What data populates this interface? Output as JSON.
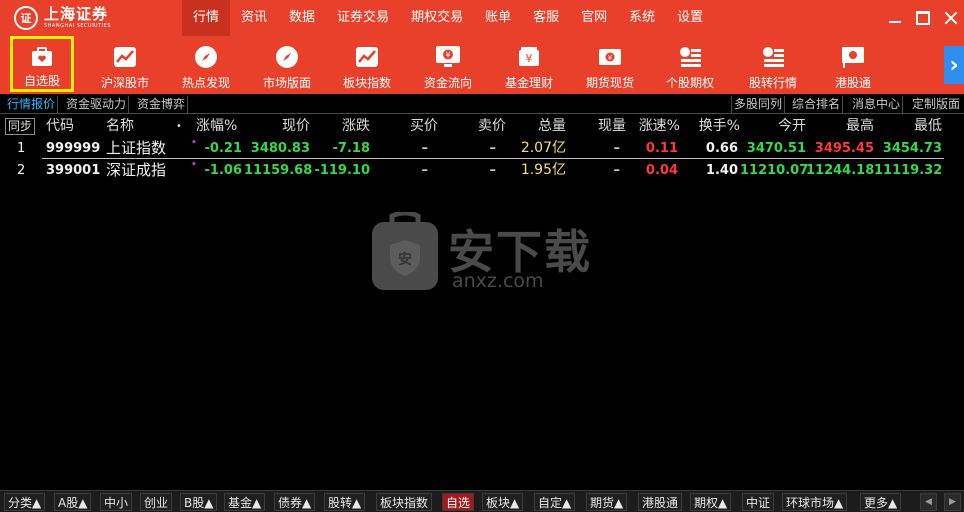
{
  "app": {
    "logo_cn": "上海证券",
    "logo_en": "SHANGHAI SECURITIES"
  },
  "menu": [
    {
      "label": "行情",
      "active": true
    },
    {
      "label": "资讯"
    },
    {
      "label": "数据"
    },
    {
      "label": "证券交易"
    },
    {
      "label": "期权交易"
    },
    {
      "label": "账单"
    },
    {
      "label": "客服"
    },
    {
      "label": "官网"
    },
    {
      "label": "系统"
    },
    {
      "label": "设置"
    }
  ],
  "toolbar": [
    {
      "label": "自选股",
      "icon": "favorites-bag-icon",
      "selected": true
    },
    {
      "label": "沪深股市",
      "icon": "trend-chart-icon"
    },
    {
      "label": "热点发现",
      "icon": "compass-icon"
    },
    {
      "label": "市场版面",
      "icon": "compass-icon"
    },
    {
      "label": "板块指数",
      "icon": "trend-chart-icon"
    },
    {
      "label": "资金流向",
      "icon": "monitor-yen-icon"
    },
    {
      "label": "基金理财",
      "icon": "yen-card-icon"
    },
    {
      "label": "期货现货",
      "icon": "banknote-icon"
    },
    {
      "label": "个股期权",
      "icon": "coin-stack-icon"
    },
    {
      "label": "股转行情",
      "icon": "coin-stack-icon"
    },
    {
      "label": "港股通",
      "icon": "hk-flag-icon"
    }
  ],
  "subtabs_left": [
    "行情报价",
    "资金驱动力",
    "资金博弈"
  ],
  "subtabs_right": [
    "多股同列",
    "综合排名",
    "消息中心",
    "定制版面"
  ],
  "table": {
    "sync_label": "同步",
    "headers": {
      "code": "代码",
      "name": "名称",
      "dot": "•",
      "change_pct": "涨幅%",
      "price": "现价",
      "change": "涨跌",
      "bid": "买价",
      "ask": "卖价",
      "volume": "总量",
      "cur_vol": "现量",
      "speed": "涨速%",
      "turnover": "换手%",
      "open": "今开",
      "high": "最高",
      "low": "最低"
    },
    "rows": [
      {
        "no": "1",
        "code": "999999",
        "name": "上证指数",
        "change_pct": "-0.21",
        "price": "3480.83",
        "change": "-7.18",
        "bid": "–",
        "ask": "–",
        "volume": "2.07亿",
        "cur_vol": "–",
        "speed": "0.11",
        "turnover": "0.66",
        "open": "3470.51",
        "high": "3495.45",
        "low": "3454.73"
      },
      {
        "no": "2",
        "code": "399001",
        "name": "深证成指",
        "change_pct": "-1.06",
        "price": "11159.68",
        "change": "-119.10",
        "bid": "–",
        "ask": "–",
        "volume": "1.95亿",
        "cur_vol": "–",
        "speed": "0.04",
        "turnover": "1.40",
        "open": "11210.07",
        "high": "11244.18",
        "low": "11119.32"
      }
    ]
  },
  "watermark": {
    "cn": "安下载",
    "en": "anxz.com",
    "badge": "安"
  },
  "bottom_tabs": [
    {
      "label": "分类▲"
    },
    {
      "label": "A股▲"
    },
    {
      "label": "中小"
    },
    {
      "label": "创业"
    },
    {
      "label": "B股▲"
    },
    {
      "label": "基金▲"
    },
    {
      "label": "债券▲"
    },
    {
      "label": "股转▲"
    },
    {
      "label": "板块指数"
    },
    {
      "label": "自选",
      "active": true
    },
    {
      "label": "板块▲"
    },
    {
      "label": "自定▲"
    },
    {
      "label": "期货▲"
    },
    {
      "label": "港股通"
    },
    {
      "label": "期权▲"
    },
    {
      "label": "中证"
    },
    {
      "label": "环球市场▲"
    },
    {
      "label": "更多▲"
    }
  ],
  "colors": {
    "brand_red": "#e8402a",
    "up_red": "#ff3838",
    "down_green": "#36d84a",
    "highlight_yellow": "#f5f000",
    "link_blue": "#2fb8ff"
  }
}
